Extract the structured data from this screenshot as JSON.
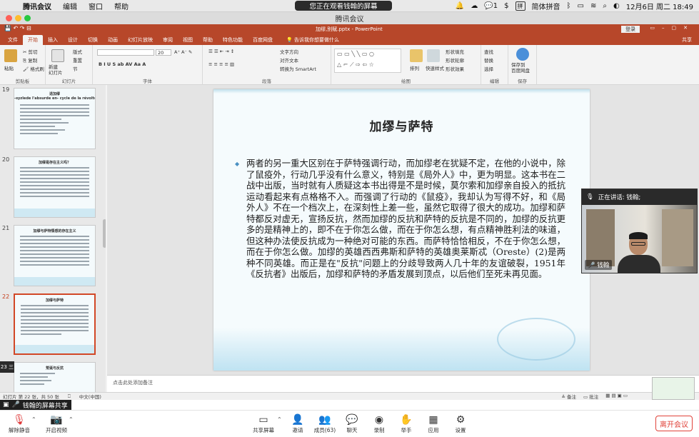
{
  "menubar": {
    "app": "腾讯会议",
    "items": [
      "编辑",
      "窗口",
      "帮助"
    ],
    "share_notice": "您正在观看钱翰的屏幕",
    "ime_label": "简体拼音",
    "datetime": "12月6日 周二  18:49",
    "wechat_count": "1"
  },
  "window": {
    "title": "腾讯会议"
  },
  "ppt": {
    "file_title": "加缪,别赋.pptx  -  PowerPoint",
    "login": "登录",
    "share": "共享",
    "tabs": [
      "文件",
      "开始",
      "插入",
      "设计",
      "切换",
      "动画",
      "幻灯片放映",
      "审阅",
      "视图",
      "帮助",
      "特色功能",
      "百度网盘"
    ],
    "active_tab": "开始",
    "tell_me": "告诉我你想要做什么",
    "ribbon": {
      "paste": "粘贴",
      "cut": "剪切",
      "copy": "复制",
      "format_painter": "格式刷",
      "clipboard": "剪贴板",
      "new_slide": "新建\n幻灯片",
      "layout": "版式",
      "reset": "重置",
      "section": "节",
      "slides": "幻灯片",
      "font_size": "20",
      "font": "字体",
      "text_direction": "文字方向",
      "align_text": "对齐文本",
      "smartart": "转换为 SmartArt",
      "paragraph": "段落",
      "arrange": "排列",
      "quick_styles": "快速样式",
      "shape_fill": "形状填充",
      "shape_outline": "形状轮廓",
      "shape_effects": "形状效果",
      "drawing": "绘图",
      "find": "查找",
      "replace": "替换",
      "select": "选择",
      "editing": "编辑",
      "save_baidu": "保存到\n百度网盘",
      "save": "保存"
    },
    "slide_panel": [
      {
        "num": "19",
        "title": "退加缪\n-syzlede l'absurde en- cycle de la révolte-"
      },
      {
        "num": "20",
        "title": "加缪是存在主义吗？"
      },
      {
        "num": "21",
        "title": "加缪与萨特情感的存在主义"
      },
      {
        "num": "22",
        "title": "加缪与萨特"
      },
      {
        "num": "23",
        "title": "荒诞与反抗"
      }
    ],
    "active_slide": "22",
    "slide": {
      "title": "加缪与萨特",
      "body": "两者的另一重大区别在于萨特强调行动，而加缪老在犹疑不定，在他的小说中，除了鼠疫外，行动几乎没有什么意义，特别是《局外人》中，更为明显。这本书在二战中出版，当时就有人质疑这本书出得是不是时候，莫尔索和加缪亲自投入的抵抗运动看起来有点格格不入。而强调了行动的《鼠疫》，我却认为写得不好，和《局外人》不在一个档次上，在深刻性上差一些，虽然它取得了很大的成功。加缪和萨特都反对虚无，宣扬反抗，然而加缪的反抗和萨特的反抗是不同的，加缪的反抗更多的是精神上的，即不在于你怎么做，而在于你怎么想，有点精神胜利法的味道，但这种办法使反抗成为一种绝对可能的东西。而萨特恰恰相反，不在于你怎么想，而在于你怎么做。加缪的英雄西西弗斯和萨特的英雄奥莱斯忒（Oreste）(2)是两种不同英雄。而正是在\"反抗\"问题上的分歧导致两人几十年的友谊破裂，1951年《反抗者》出版后，加缪和萨特的矛盾发展到顶点，以后他们至死未再见面。"
    },
    "notes_placeholder": "点击此处添加备注",
    "status": {
      "slide_count": "幻灯片 第 22 张，共 50 张",
      "language": "中文(中国)",
      "notes": "备注",
      "comments": "批注"
    }
  },
  "speaker": {
    "header": "正在讲话: 钱翰;",
    "name": "钱翰"
  },
  "meeting": {
    "sharing_banner": "钱翰的屏幕共享",
    "side_toggle": "23 三",
    "buttons": {
      "mute": "解除静音",
      "video": "开启视频",
      "share_screen": "共享屏幕",
      "invite": "邀请",
      "members": "成员(63)",
      "chat": "聊天",
      "record": "录制",
      "raise_hand": "举手",
      "apps": "应用",
      "settings": "设置",
      "leave": "离开会议"
    }
  },
  "colors": {
    "ppt_accent": "#b7472a",
    "leave_red": "#e0433a",
    "active_thumb_border": "#d24726"
  }
}
